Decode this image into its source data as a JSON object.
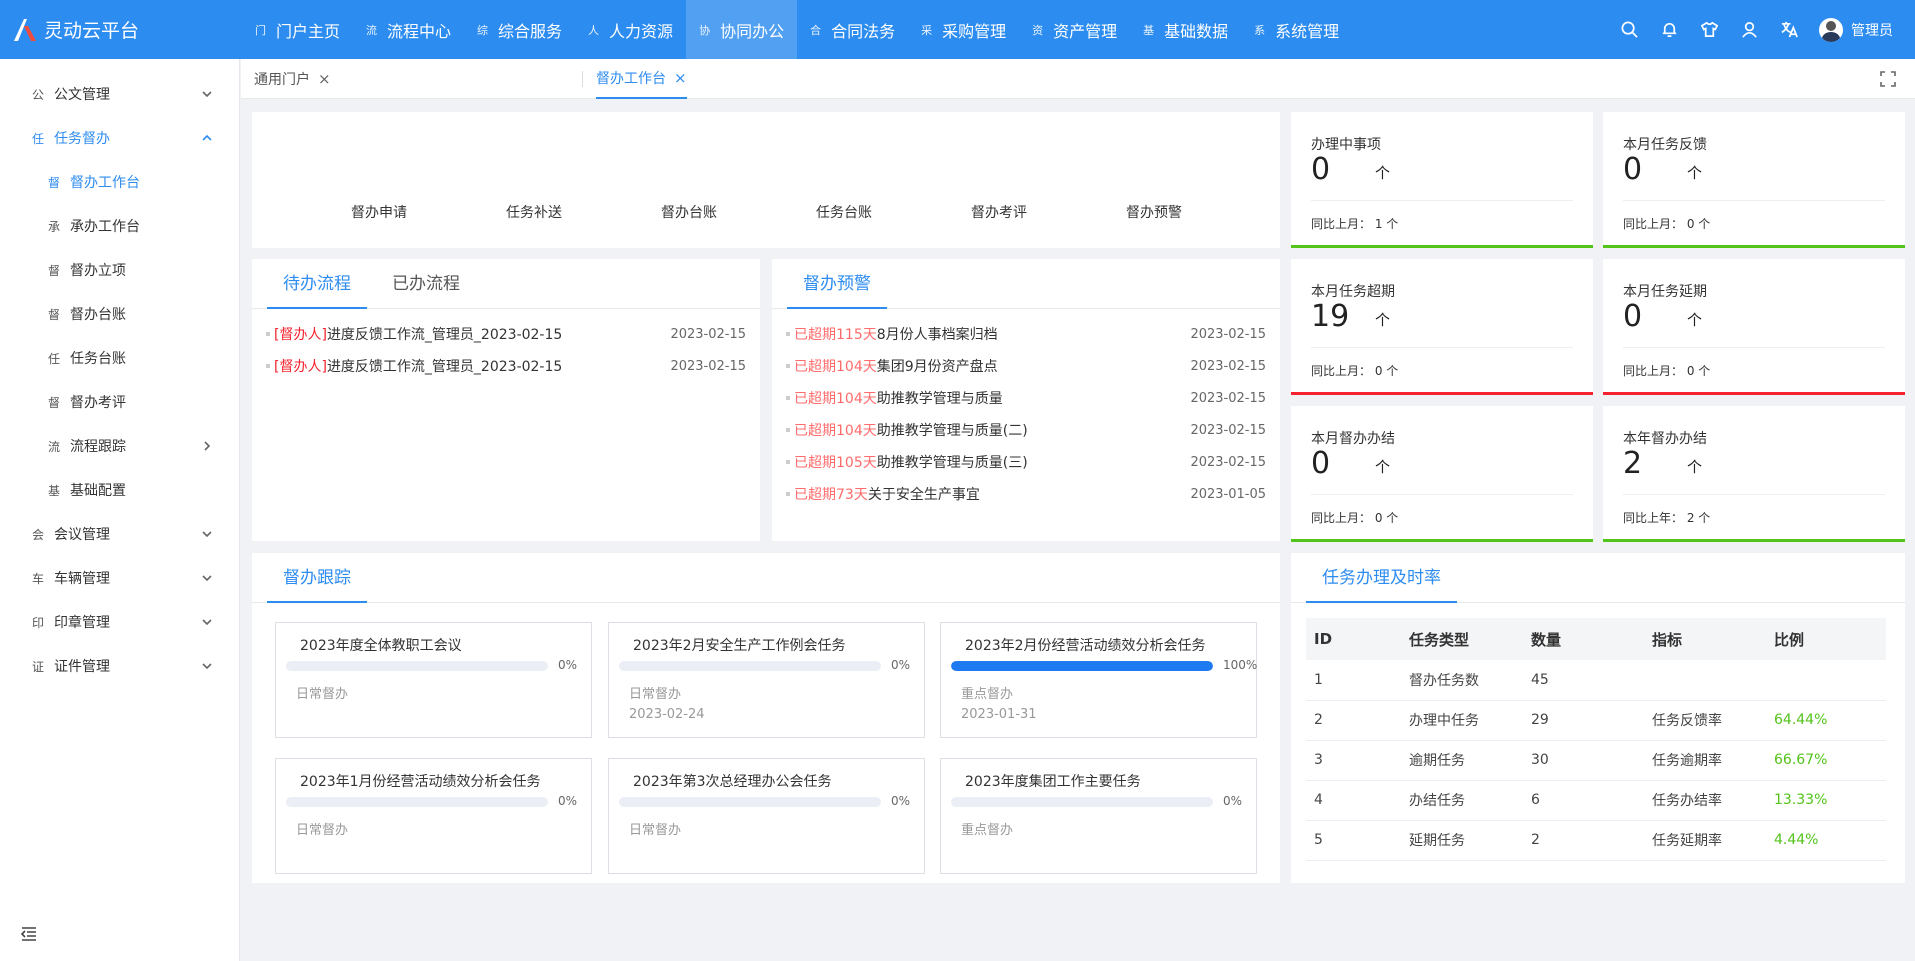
{
  "app": {
    "title": "灵动云平台"
  },
  "nav": [
    {
      "icon": "门",
      "label": "门户主页"
    },
    {
      "icon": "流",
      "label": "流程中心"
    },
    {
      "icon": "综",
      "label": "综合服务"
    },
    {
      "icon": "人",
      "label": "人力资源"
    },
    {
      "icon": "协",
      "label": "协同办公"
    },
    {
      "icon": "合",
      "label": "合同法务"
    },
    {
      "icon": "采",
      "label": "采购管理"
    },
    {
      "icon": "资",
      "label": "资产管理"
    },
    {
      "icon": "基",
      "label": "基础数据"
    },
    {
      "icon": "系",
      "label": "系统管理"
    }
  ],
  "user": {
    "name": "管理员"
  },
  "sidebar": {
    "items": [
      {
        "icon": "公",
        "label": "公文管理"
      },
      {
        "icon": "任",
        "label": "任务督办"
      },
      {
        "icon": "督",
        "label": "督办工作台"
      },
      {
        "icon": "承",
        "label": "承办工作台"
      },
      {
        "icon": "督",
        "label": "督办立项"
      },
      {
        "icon": "督",
        "label": "督办台账"
      },
      {
        "icon": "任",
        "label": "任务台账"
      },
      {
        "icon": "督",
        "label": "督办考评"
      },
      {
        "icon": "流",
        "label": "流程跟踪"
      },
      {
        "icon": "基",
        "label": "基础配置"
      },
      {
        "icon": "会",
        "label": "会议管理"
      },
      {
        "icon": "车",
        "label": "车辆管理"
      },
      {
        "icon": "印",
        "label": "印章管理"
      },
      {
        "icon": "证",
        "label": "证件管理"
      }
    ]
  },
  "tabs": [
    {
      "label": "通用门户"
    },
    {
      "label": "督办工作台"
    }
  ],
  "quick_links": [
    "督办申请",
    "任务补送",
    "督办台账",
    "任务台账",
    "督办考评",
    "督办预警"
  ],
  "stats": [
    {
      "title": "办理中事项",
      "value": "0",
      "unit": "个",
      "compare": "同比上月：  1 个"
    },
    {
      "title": "本月任务反馈",
      "value": "0",
      "unit": "个",
      "compare": "同比上月：  0 个"
    },
    {
      "title": "本月任务超期",
      "value": "19",
      "unit": "个",
      "compare": "同比上月：  0 个"
    },
    {
      "title": "本月任务延期",
      "value": "0",
      "unit": "个",
      "compare": "同比上月：  0 个"
    },
    {
      "title": "本月督办办结",
      "value": "0",
      "unit": "个",
      "compare": "同比上月：  0 个"
    },
    {
      "title": "本年督办办结",
      "value": "2",
      "unit": "个",
      "compare": "同比上年：  2 个"
    }
  ],
  "colors": {
    "primary": "#2d8cf0",
    "green": "#52c41a",
    "red": "#f5222d"
  },
  "process": {
    "tabs": [
      "待办流程",
      "已办流程"
    ],
    "rows": [
      {
        "tag": "[督办人]",
        "title": "进度反馈工作流_管理员_2023-02-15",
        "date": "2023-02-15"
      },
      {
        "tag": "[督办人]",
        "title": "进度反馈工作流_管理员_2023-02-15",
        "date": "2023-02-15"
      }
    ]
  },
  "warning": {
    "title": "督办预警",
    "rows": [
      {
        "tag": "已超期115天",
        "title": "8月份人事档案归档",
        "date": "2023-02-15"
      },
      {
        "tag": "已超期104天",
        "title": "集团9月份资产盘点",
        "date": "2023-02-15"
      },
      {
        "tag": "已超期104天",
        "title": "助推教学管理与质量",
        "date": "2023-02-15"
      },
      {
        "tag": "已超期104天",
        "title": "助推教学管理与质量(二)",
        "date": "2023-02-15"
      },
      {
        "tag": "已超期105天",
        "title": "助推教学管理与质量(三)",
        "date": "2023-02-15"
      },
      {
        "tag": "已超期73天",
        "title": "关于安全生产事宜",
        "date": "2023-01-05"
      }
    ]
  },
  "tracking": {
    "title": "督办跟踪",
    "items": [
      {
        "title": "2023年度全体教职工会议",
        "progress": 0,
        "pct": "0%",
        "kind": "日常督办",
        "date": ""
      },
      {
        "title": "2023年2月安全生产工作例会任务",
        "progress": 0,
        "pct": "0%",
        "kind": "日常督办",
        "date": "2023-02-24"
      },
      {
        "title": "2023年2月份经营活动绩效分析会任务",
        "progress": 1,
        "pct": "100%",
        "kind": "重点督办",
        "date": "2023-01-31"
      },
      {
        "title": "2023年1月份经营活动绩效分析会任务",
        "progress": 0,
        "pct": "0%",
        "kind": "日常督办",
        "date": ""
      },
      {
        "title": "2023年第3次总经理办公会任务",
        "progress": 0,
        "pct": "0%",
        "kind": "日常督办",
        "date": ""
      },
      {
        "title": "2023年度集团工作主要任务",
        "progress": 0,
        "pct": "0%",
        "kind": "重点督办",
        "date": ""
      }
    ]
  },
  "rate_table": {
    "title": "任务办理及时率",
    "headers": [
      "ID",
      "任务类型",
      "数量",
      "指标",
      "比例"
    ],
    "rows": [
      [
        "1",
        "督办任务数",
        "45",
        "",
        ""
      ],
      [
        "2",
        "办理中任务",
        "29",
        "任务反馈率",
        "64.44%"
      ],
      [
        "3",
        "逾期任务",
        "30",
        "任务逾期率",
        "66.67%"
      ],
      [
        "4",
        "办结任务",
        "6",
        "任务办结率",
        "13.33%"
      ],
      [
        "5",
        "延期任务",
        "2",
        "任务延期率",
        "4.44%"
      ]
    ]
  }
}
